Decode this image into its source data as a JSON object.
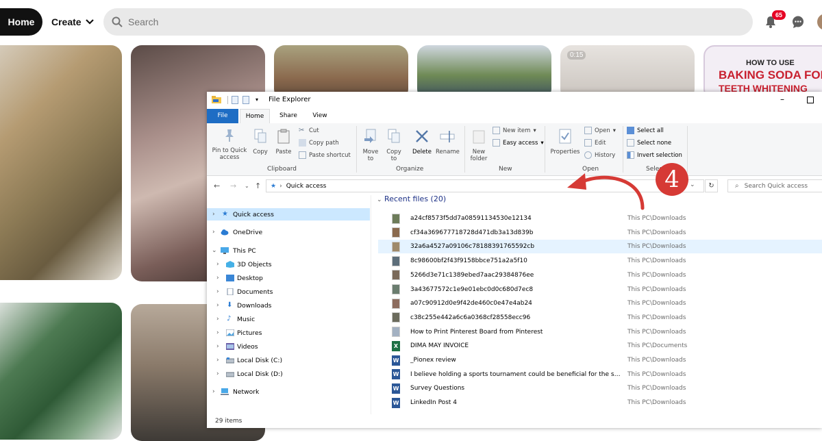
{
  "pinterest": {
    "home_label": "Home",
    "create_label": "Create",
    "search_placeholder": "Search",
    "notification_count": "65",
    "pins": {
      "video_duration": "0:15",
      "text_pin_line1": "HOW TO USE",
      "text_pin_line2": "BAKING SODA FOR",
      "text_pin_line3": "TEETH WHITENING"
    }
  },
  "explorer": {
    "title": "File Explorer",
    "tabs": [
      "File",
      "Home",
      "Share",
      "View"
    ],
    "ribbon": {
      "clipboard": {
        "label": "Clipboard",
        "pin_quick_access": "Pin to Quick access",
        "copy": "Copy",
        "paste": "Paste",
        "cut": "Cut",
        "copy_path": "Copy path",
        "paste_shortcut": "Paste shortcut"
      },
      "organize": {
        "label": "Organize",
        "move_to": "Move to",
        "copy_to": "Copy to",
        "delete": "Delete",
        "rename": "Rename"
      },
      "new": {
        "label": "New",
        "new_folder": "New folder",
        "new_item": "New item",
        "easy_access": "Easy access"
      },
      "open": {
        "label": "Open",
        "properties": "Properties",
        "open": "Open",
        "edit": "Edit",
        "history": "History"
      },
      "select": {
        "label": "Select",
        "select_all": "Select all",
        "select_none": "Select none",
        "invert_selection": "Invert selection"
      }
    },
    "address": {
      "path": "Quick access",
      "search_placeholder": "Search Quick access"
    },
    "nav": [
      {
        "label": "Quick access",
        "selected": true
      },
      {
        "label": "OneDrive"
      },
      {
        "label": "This PC"
      },
      {
        "label": "3D Objects"
      },
      {
        "label": "Desktop"
      },
      {
        "label": "Documents"
      },
      {
        "label": "Downloads"
      },
      {
        "label": "Music"
      },
      {
        "label": "Pictures"
      },
      {
        "label": "Videos"
      },
      {
        "label": "Local Disk (C:)"
      },
      {
        "label": "Local Disk (D:)"
      },
      {
        "label": "Network"
      }
    ],
    "recent_header": "Recent files (20)",
    "files": [
      {
        "name": "a24cf8573f5dd7a08591134530e12134",
        "location": "This PC\\Downloads",
        "type": "image"
      },
      {
        "name": "cf34a369677718728d471db3a13d839b",
        "location": "This PC\\Downloads",
        "type": "image"
      },
      {
        "name": "32a6a4527a09106c78188391765592cb",
        "location": "This PC\\Downloads",
        "type": "image",
        "selected": true
      },
      {
        "name": "8c98600bf2f43f9158bbce751a2a5f10",
        "location": "This PC\\Downloads",
        "type": "image"
      },
      {
        "name": "5266d3e71c1389ebed7aac29384876ee",
        "location": "This PC\\Downloads",
        "type": "image"
      },
      {
        "name": "3a43677572c1e9e01ebc0d0c680d7ec8",
        "location": "This PC\\Downloads",
        "type": "image"
      },
      {
        "name": "a07c90912d0e9f42de460c0e47e4ab24",
        "location": "This PC\\Downloads",
        "type": "image"
      },
      {
        "name": "c38c255e442a6c6a0368cf28558ecc96",
        "location": "This PC\\Downloads",
        "type": "image"
      },
      {
        "name": "How to Print Pinterest Board from Pinterest",
        "location": "This PC\\Downloads",
        "type": "image"
      },
      {
        "name": "DIMA MAY INVOICE",
        "location": "This PC\\Documents",
        "type": "excel"
      },
      {
        "name": "_Pionex review",
        "location": "This PC\\Downloads",
        "type": "word"
      },
      {
        "name": "I believe holding a sports tournament could be beneficial for the stu...",
        "location": "This PC\\Downloads",
        "type": "word"
      },
      {
        "name": "Survey Questions",
        "location": "This PC\\Downloads",
        "type": "word"
      },
      {
        "name": "LinkedIn Post 4",
        "location": "This PC\\Downloads",
        "type": "word"
      }
    ],
    "status": "29 items"
  },
  "annotation": {
    "step_number": "4",
    "color": "#d63a35"
  }
}
